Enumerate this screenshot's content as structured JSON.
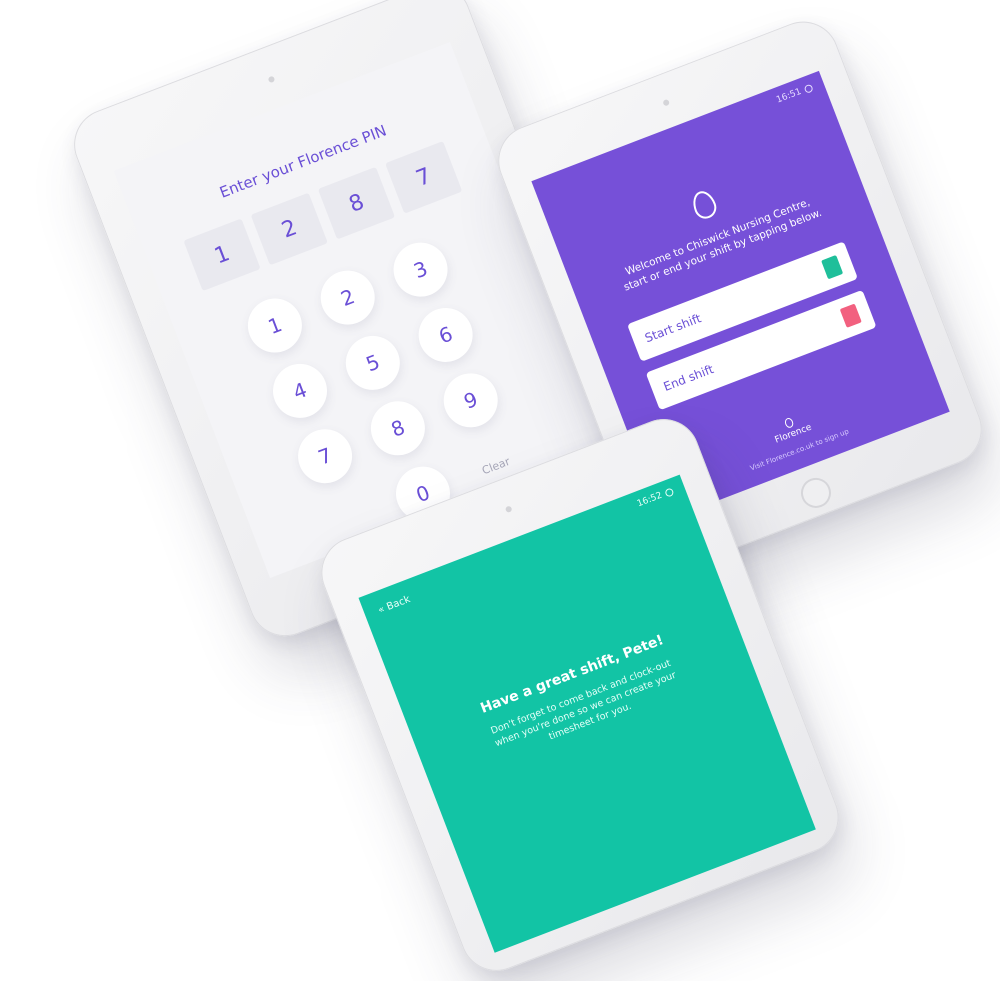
{
  "pin": {
    "title": "Enter your Florence PIN",
    "entered": [
      "1",
      "2",
      "8",
      "7"
    ],
    "keys": [
      "1",
      "2",
      "3",
      "4",
      "5",
      "6",
      "7",
      "8",
      "9",
      "",
      "0",
      "Clear"
    ]
  },
  "welcome": {
    "time": "16:51",
    "message_line1": "Welcome to Chiswick Nursing Centre,",
    "message_line2": "start or end your shift by tapping below.",
    "start_label": "Start shift",
    "end_label": "End shift",
    "brand": "Florence",
    "signup": "Visit Florence.co.uk to sign up"
  },
  "goodbye": {
    "time": "16:52",
    "back_label": "Back",
    "title": "Have a great shift, Pete!",
    "message_line1": "Don't forget to come back and clock-out",
    "message_line2": "when you're done so we can create your",
    "message_line3": "timesheet for you."
  },
  "colors": {
    "purple": "#7650d8",
    "teal": "#12c4a5",
    "accent_text": "#6a4fd6"
  }
}
